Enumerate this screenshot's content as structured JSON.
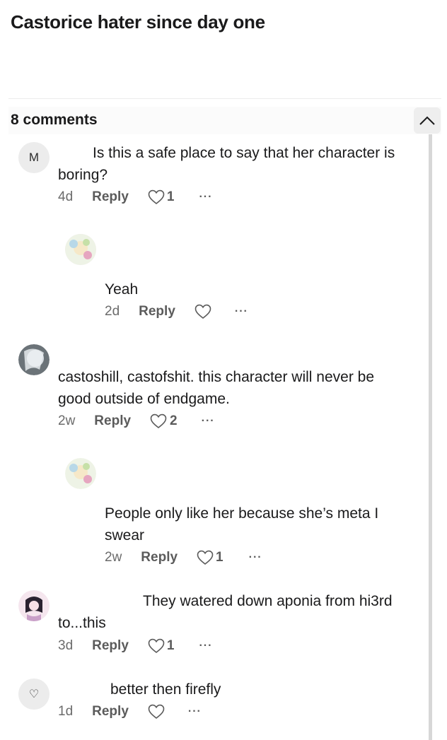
{
  "post": {
    "title": "Castorice hater since day one"
  },
  "comments_header": {
    "count_label": "8 comments"
  },
  "comments": [
    {
      "avatar_letter": "M",
      "text": "Is this a safe place to say that her character is boring?",
      "line1": "Is this a safe place to say that her character is",
      "line2": "boring?",
      "time": "4d",
      "reply": "Reply",
      "likes": "1",
      "more": "···"
    },
    {
      "text": "Yeah",
      "time": "2d",
      "reply": "Reply",
      "likes": "",
      "more": "···"
    },
    {
      "text": "castoshill, castofshit. this character will never be good outside of endgame.",
      "line1": "castoshill, castofshit. this character will never be",
      "line2": "good outside of endgame.",
      "time": "2w",
      "reply": "Reply",
      "likes": "2",
      "more": "···"
    },
    {
      "text": "People only like her because she’s meta I swear",
      "line1": "People only like her because she’s meta I",
      "line2": "swear",
      "time": "2w",
      "reply": "Reply",
      "likes": "1",
      "more": "···"
    },
    {
      "text": "They watered down aponia from hi3rd to...this",
      "line1": "They watered down aponia from hi3rd",
      "line2": "to...this",
      "time": "3d",
      "reply": "Reply",
      "likes": "1",
      "more": "···"
    },
    {
      "avatar_letter": "♡",
      "text": "better then firefly",
      "time": "1d",
      "reply": "Reply",
      "likes": "",
      "more": "···"
    }
  ],
  "colors": {
    "text": "#1a1a1b",
    "muted": "#5b5b5b",
    "avatar_bg": "#ececec"
  }
}
